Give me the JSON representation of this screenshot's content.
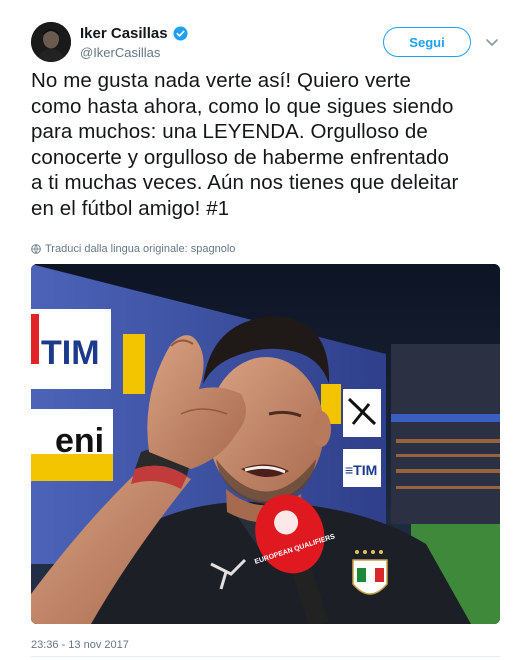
{
  "user": {
    "name": "Iker Casillas",
    "handle": "@IkerCasillas",
    "follow_label": "Segui"
  },
  "tweet": {
    "text": "No me gusta nada verte así! Quiero verte\ncomo hasta ahora, como lo que sigues siendo\npara muchos: una LEYENDA. Orgulloso de\nconocerte y orgulloso de haberme enfrentado\na ti muchas veces. Aún nos tienes que deleitar\nen el fútbol amigo! #1",
    "translate_note": "Traduci dalla lingua originale: spagnolo",
    "timestamp": "23:36 - 13 nov 2017"
  },
  "photo": {
    "board_text_tim": "TIM",
    "board_text_eni": "eni",
    "mic_text": "EUROPEAN QUALIFIERS"
  },
  "colors": {
    "accent": "#1da1f2",
    "text": "#14171a",
    "muted": "#657786"
  },
  "icons": {
    "verified": "verified-badge-icon",
    "caret": "chevron-down-icon",
    "globe": "globe-icon"
  }
}
